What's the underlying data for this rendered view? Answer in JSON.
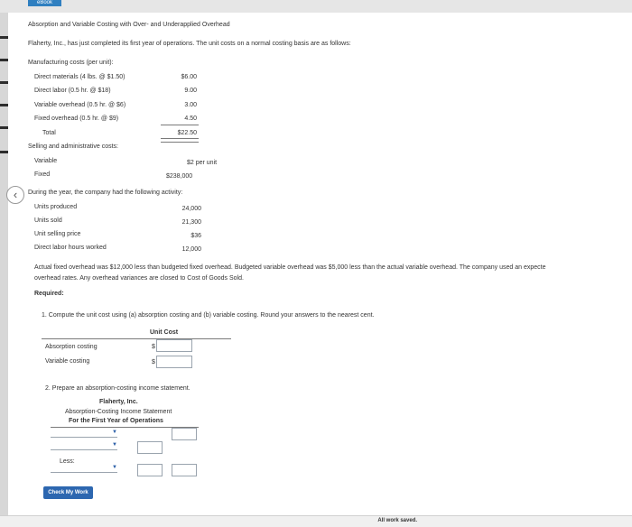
{
  "header": {
    "tab_label": "eBook"
  },
  "problem": {
    "title": "Absorption and Variable Costing with Over- and Underapplied Overhead",
    "intro": "Flaherty, Inc., has just completed its first year of operations. The unit costs on a normal costing basis are as follows:",
    "mfg_heading": "Manufacturing costs (per unit):",
    "mfg_items": [
      {
        "label": "Direct materials (4 lbs. @ $1.50)",
        "value": "$6.00"
      },
      {
        "label": "Direct labor (0.5 hr. @ $18)",
        "value": "9.00"
      },
      {
        "label": "Variable overhead (0.5 hr. @ $6)",
        "value": "3.00"
      },
      {
        "label": "Fixed overhead (0.5 hr. @ $9)",
        "value": "4.50"
      }
    ],
    "total_label": "Total",
    "total_value": "$22.50",
    "sga_heading": "Selling and administrative costs:",
    "sga_items": [
      {
        "label": "Variable",
        "value": "$2 per unit"
      },
      {
        "label": "Fixed",
        "value": "$238,000"
      }
    ],
    "activity_heading": "During the year, the company had the following activity:",
    "activity_items": [
      {
        "label": "Units produced",
        "value": "24,000"
      },
      {
        "label": "Units sold",
        "value": "21,300"
      },
      {
        "label": "Unit selling price",
        "value": "$36"
      },
      {
        "label": "Direct labor hours worked",
        "value": "12,000"
      }
    ],
    "note_line1": "Actual fixed overhead was $12,000 less than budgeted fixed overhead. Budgeted variable overhead was $5,000 less than the actual variable overhead. The company used an expecte",
    "note_line2": "overhead rates. Any overhead variances are closed to Cost of Goods Sold.",
    "required_label": "Required:"
  },
  "q1": {
    "prompt": "1. Compute the unit cost using (a) absorption costing and (b) variable costing. Round your answers to the nearest cent.",
    "col_header": "Unit Cost",
    "rows": [
      {
        "label": "Absorption costing",
        "currency": "$"
      },
      {
        "label": "Variable costing",
        "currency": "$"
      }
    ]
  },
  "q2": {
    "prompt": "2. Prepare an absorption-costing income statement.",
    "company": "Flaherty, Inc.",
    "statement_title": "Absorption-Costing Income Statement",
    "period": "For the First Year of Operations",
    "less_label": "Less:"
  },
  "actions": {
    "check_label": "Check My Work"
  },
  "status": {
    "saved_text": "All work saved."
  }
}
